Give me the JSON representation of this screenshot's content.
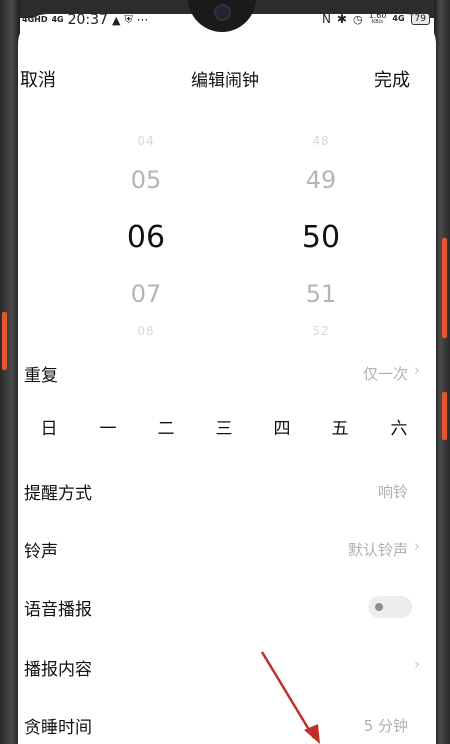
{
  "status_bar": {
    "signal1": "4GHD",
    "signal2": "4G",
    "time": "20:37",
    "more": "···",
    "speed": "1.60",
    "speed_unit": "KB/s",
    "net": "4G",
    "battery": "79"
  },
  "header": {
    "cancel": "取消",
    "title": "编辑闹钟",
    "done": "完成"
  },
  "picker": {
    "hours": [
      "04",
      "05",
      "06",
      "07",
      "08"
    ],
    "minutes": [
      "48",
      "49",
      "50",
      "51",
      "52"
    ],
    "selected_hour": "06",
    "selected_minute": "50"
  },
  "repeat": {
    "label": "重复",
    "value": "仅一次"
  },
  "weekdays": [
    "日",
    "一",
    "二",
    "三",
    "四",
    "五",
    "六"
  ],
  "reminder": {
    "label": "提醒方式",
    "value": "响铃"
  },
  "ringtone": {
    "label": "铃声",
    "value": "默认铃声"
  },
  "voice": {
    "label": "语音播报",
    "enabled": false
  },
  "broadcast": {
    "label": "播报内容"
  },
  "snooze": {
    "label": "贪睡时间",
    "value": "5 分钟"
  },
  "colors": {
    "accent_button": "#e4572e",
    "arrow": "#c0302a"
  }
}
